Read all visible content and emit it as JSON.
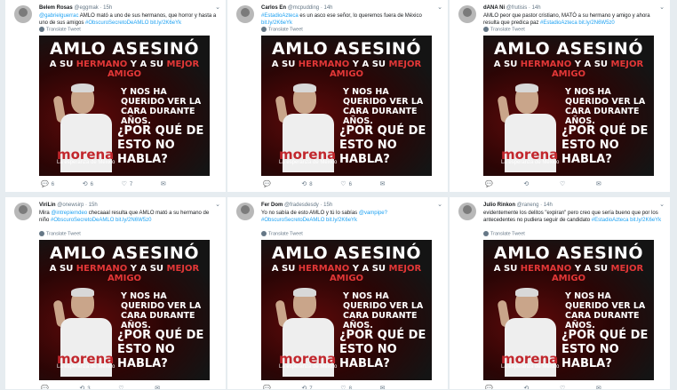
{
  "tweets": [
    {
      "name": "Belem Rosas",
      "handle": "@eggmak",
      "time": "15h",
      "pre": "",
      "mention": "@gabrielguerrac",
      "text": " AMLO mató a uno de sus hermanos, que horror y hasta a uno de sus amigos ",
      "tag": "#ObscuroSecretoDeAMLO",
      "link": " bit.ly/2K6eYk",
      "translate": "Translate Tweet",
      "replies": "6",
      "retweets": "6",
      "likes": "7"
    },
    {
      "name": "Carlos En",
      "handle": "@mcpudding",
      "time": "14h",
      "pre": "",
      "mention": "#EstadioAzteca",
      "text": " es un asco ese señor, lo queremos fuera de México",
      "tag": "",
      "link": " bit.ly/2K6eYk",
      "translate": "Translate Tweet",
      "replies": "",
      "retweets": "8",
      "likes": "6"
    },
    {
      "name": "dANA Ni",
      "handle": "@frutisis",
      "time": "14h",
      "pre": "",
      "mention": "",
      "text": "AMLO peor que pastor cristiano, MATÓ a su hermano y amigo y ahora resulta que predica paz ",
      "tag": "#EstadioAzteca",
      "link": " bit.ly/2N6W5z0",
      "translate": "Translate Tweet",
      "replies": "",
      "retweets": "",
      "likes": ""
    },
    {
      "name": "ViriLin",
      "handle": "@onewsirp",
      "time": "15h",
      "pre": "Mira ",
      "mention": "@intrepiemdeo",
      "text": " checaaal resulta que AMLO mató a su hermano de niño ",
      "tag": "#ObscuroSecretoDeAMLO",
      "link": " bit.ly/2N6W5z0",
      "translate": "Translate Tweet",
      "replies": "",
      "retweets": "3",
      "likes": ""
    },
    {
      "name": "Fer Dom",
      "handle": "@fradesdesdy",
      "time": "15h",
      "pre": "",
      "mention": "",
      "text": "Yo no sabía de esto AMLO y tú lo sabías ",
      "tag": "@vampipe? #ObscuroSecretoDeAMLO",
      "link": " bit.ly/2K6eYk",
      "translate": "Translate Tweet",
      "replies": "",
      "retweets": "7",
      "likes": "8"
    },
    {
      "name": "Julio Rinkon",
      "handle": "@raneng",
      "time": "14h",
      "pre": "",
      "mention": "",
      "text": "evidentemente los delitos \"expiran\" pero creo que sería bueno que por los antecedentes no pudiera seguir de candidato ",
      "tag": "#EstadioAzteca",
      "link": " bit.ly/2K6eYk",
      "translate": "Translate Tweet",
      "replies": "",
      "retweets": "",
      "likes": ""
    }
  ],
  "poster": {
    "title": "AMLO ASESINÓ",
    "line2_a": "A SU ",
    "line2_b": "HERMANO",
    "line2_c": " Y A SU ",
    "line2_d": "MEJOR AMIGO",
    "line3": "Y NOS HA QUERIDO VER LA CARA DURANTE AÑOS.",
    "line4": "¿POR QUÉ DE ESTO NO HABLA?",
    "logo": "morena",
    "logo_sub": "La esperanza de México"
  },
  "icons": {
    "reply": "reply-icon",
    "retweet": "retweet-icon",
    "like": "like-icon",
    "dm": "message-icon",
    "more": "chevron-down-icon",
    "translate": "globe-icon"
  }
}
